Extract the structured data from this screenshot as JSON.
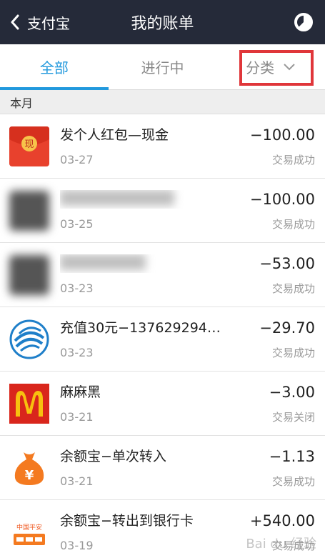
{
  "navbar": {
    "back_label": "支付宝",
    "title": "我的账单",
    "back_icon": "chevron-left-icon",
    "chart_icon": "pie-chart-icon"
  },
  "tabs": [
    {
      "label": "全部",
      "active": true
    },
    {
      "label": "进行中",
      "active": false
    },
    {
      "label": "分类",
      "active": false
    }
  ],
  "section": {
    "label": "本月"
  },
  "transactions": [
    {
      "name": "发个人红包—现金",
      "date": "03-27",
      "amount": "−100.00",
      "status": "交易成功",
      "icon": "red-envelope-icon",
      "icon_text": "现"
    },
    {
      "name": "",
      "date": "03-25",
      "amount": "−100.00",
      "status": "交易成功",
      "icon": "blurred-avatar-icon"
    },
    {
      "name": "",
      "date": "03-23",
      "amount": "−53.00",
      "status": "交易成功",
      "icon": "blurred-avatar-icon"
    },
    {
      "name": "充值30元−137629294…",
      "date": "03-23",
      "amount": "−29.70",
      "status": "交易成功",
      "icon": "china-mobile-icon"
    },
    {
      "name": "麻麻黑",
      "date": "03-21",
      "amount": "−3.00",
      "status": "交易关闭",
      "icon": "mcdonalds-icon",
      "icon_text": "M"
    },
    {
      "name": "余额宝−单次转入",
      "date": "03-21",
      "amount": "−1.13",
      "status": "交易成功",
      "icon": "money-bag-icon",
      "icon_text": "¥"
    },
    {
      "name": "余额宝−转出到银行卡",
      "date": "03-19",
      "amount": "+540.00",
      "status": "交易成功",
      "icon": "ping-an-bank-icon",
      "icon_text": "中国平安"
    }
  ],
  "colors": {
    "navbar_bg": "#252a39",
    "accent": "#2299dd",
    "highlight_box": "#e0363a"
  },
  "watermark": "Bai du 经验"
}
